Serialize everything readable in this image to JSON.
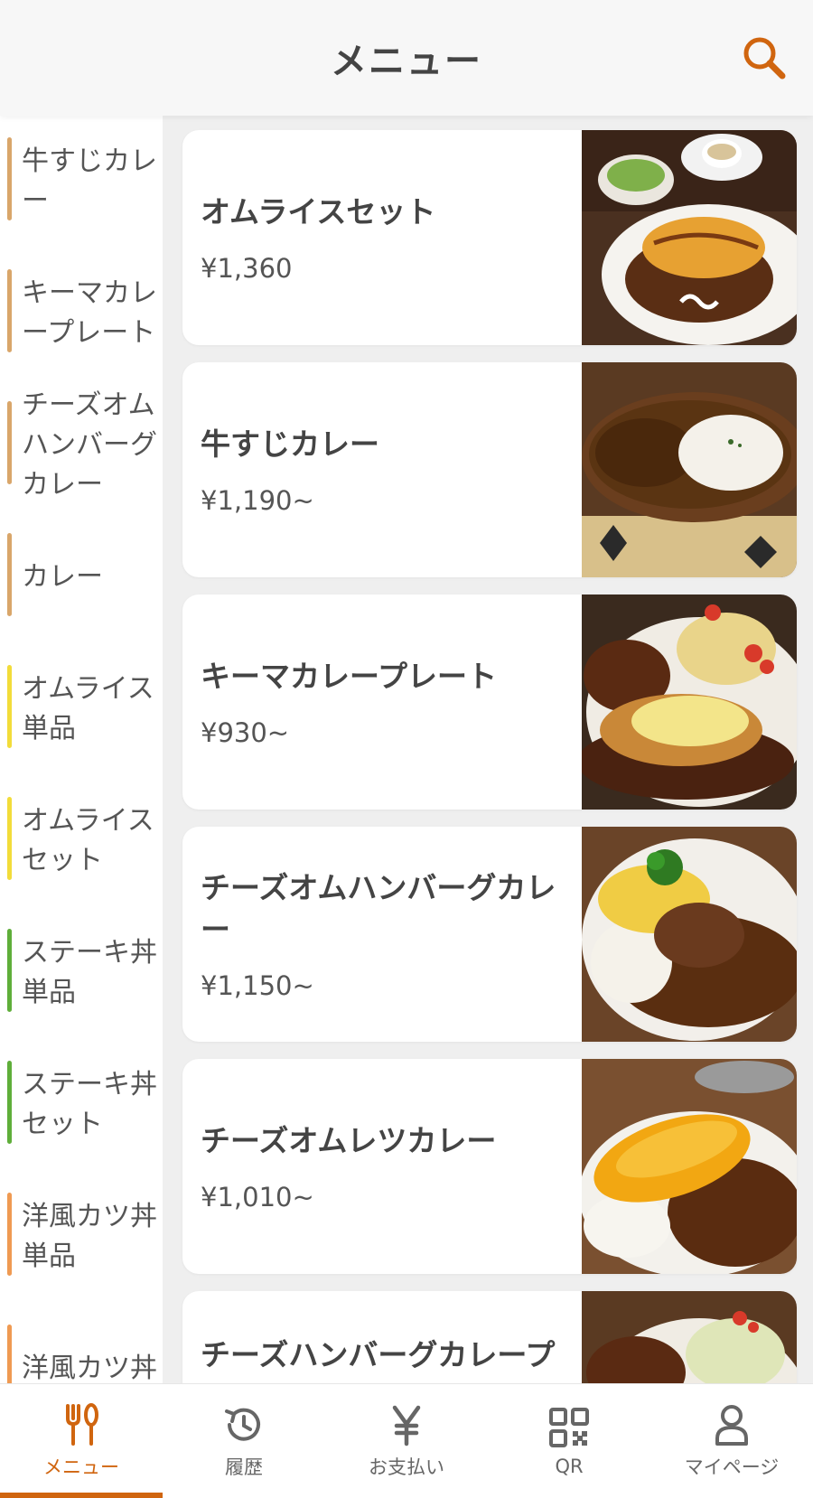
{
  "header": {
    "title": "メニュー",
    "search_icon": "search-icon"
  },
  "sidebar": {
    "items": [
      {
        "label": "牛すじカレー",
        "color": "#d9a66a"
      },
      {
        "label": "キーマカレープレート",
        "color": "#d9a66a"
      },
      {
        "label": "チーズオムハンバーグカレー",
        "color": "#d9a66a"
      },
      {
        "label": "カレー",
        "color": "#d9a66a"
      },
      {
        "label": "オムライス単品",
        "color": "#f2dc3a"
      },
      {
        "label": "オムライスセット",
        "color": "#f2dc3a"
      },
      {
        "label": "ステーキ丼単品",
        "color": "#5fae3a"
      },
      {
        "label": "ステーキ丼セット",
        "color": "#5fae3a"
      },
      {
        "label": "洋風カツ丼単品",
        "color": "#ef9a52"
      },
      {
        "label": "洋風カツ丼",
        "color": "#ef9a52"
      }
    ]
  },
  "menu": {
    "items": [
      {
        "name": "オムライスセット",
        "price": "¥1,360"
      },
      {
        "name": "牛すじカレー",
        "price": "¥1,190~"
      },
      {
        "name": "キーマカレープレート",
        "price": "¥930~"
      },
      {
        "name": "チーズオムハンバーグカレー",
        "price": "¥1,150~"
      },
      {
        "name": "チーズオムレツカレー",
        "price": "¥1,010~"
      },
      {
        "name": "チーズハンバーグカレープ",
        "price": ""
      }
    ]
  },
  "tabbar": {
    "items": [
      {
        "label": "メニュー",
        "icon": "fork-knife-icon",
        "active": true
      },
      {
        "label": "履歴",
        "icon": "history-icon",
        "active": false
      },
      {
        "label": "お支払い",
        "icon": "yen-icon",
        "active": false
      },
      {
        "label": "QR",
        "icon": "qr-code-icon",
        "active": false
      },
      {
        "label": "マイページ",
        "icon": "person-icon",
        "active": false
      }
    ]
  },
  "colors": {
    "accent": "#d0650f",
    "text": "#444444"
  }
}
